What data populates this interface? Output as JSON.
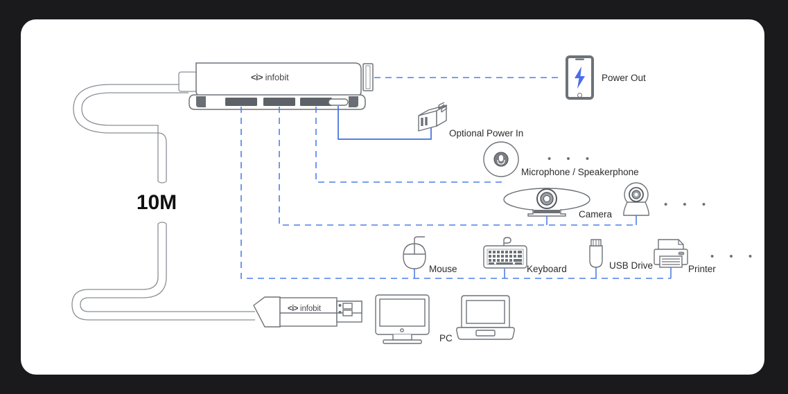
{
  "page": {
    "background_color": "#1a1a1d",
    "card_color": "#ffffff",
    "line_color": "#4d7fe8",
    "outline_color": "#6d7278",
    "text_color": "#2b2b2b"
  },
  "brand": {
    "mark": "<i>",
    "name": "infobit"
  },
  "cable": {
    "length_label": "10M"
  },
  "hub": {
    "name": "usb-hub",
    "ports": [
      {
        "name": "usb-a-port-1",
        "type": "usb-a"
      },
      {
        "name": "usb-a-port-2",
        "type": "usb-a"
      },
      {
        "name": "usb-a-port-3",
        "type": "usb-a"
      },
      {
        "name": "usb-c-port",
        "type": "usb-c"
      }
    ]
  },
  "connector": {
    "name": "usb-a-connector",
    "label_mark": "<i>",
    "label_name": "infobit"
  },
  "devices": [
    {
      "id": "power-out",
      "label": "Power Out",
      "icon": "phone-charging-icon"
    },
    {
      "id": "power-in",
      "label": "Optional Power In",
      "icon": "power-adapter-icon"
    },
    {
      "id": "microphone",
      "label": "Microphone / Speakerphone",
      "icon": "speakerphone-icon"
    },
    {
      "id": "camera",
      "label": "Camera",
      "icon": "conference-camera-icon"
    },
    {
      "id": "mouse",
      "label": "Mouse",
      "icon": "mouse-icon"
    },
    {
      "id": "keyboard",
      "label": "Keyboard",
      "icon": "keyboard-icon"
    },
    {
      "id": "usb-drive",
      "label": "USB Drive",
      "icon": "usb-drive-icon"
    },
    {
      "id": "printer",
      "label": "Printer",
      "icon": "printer-icon"
    },
    {
      "id": "pc",
      "label": "PC",
      "icon": "monitor-laptop-icon"
    }
  ],
  "ellipsis": {
    "text": "• • •"
  }
}
